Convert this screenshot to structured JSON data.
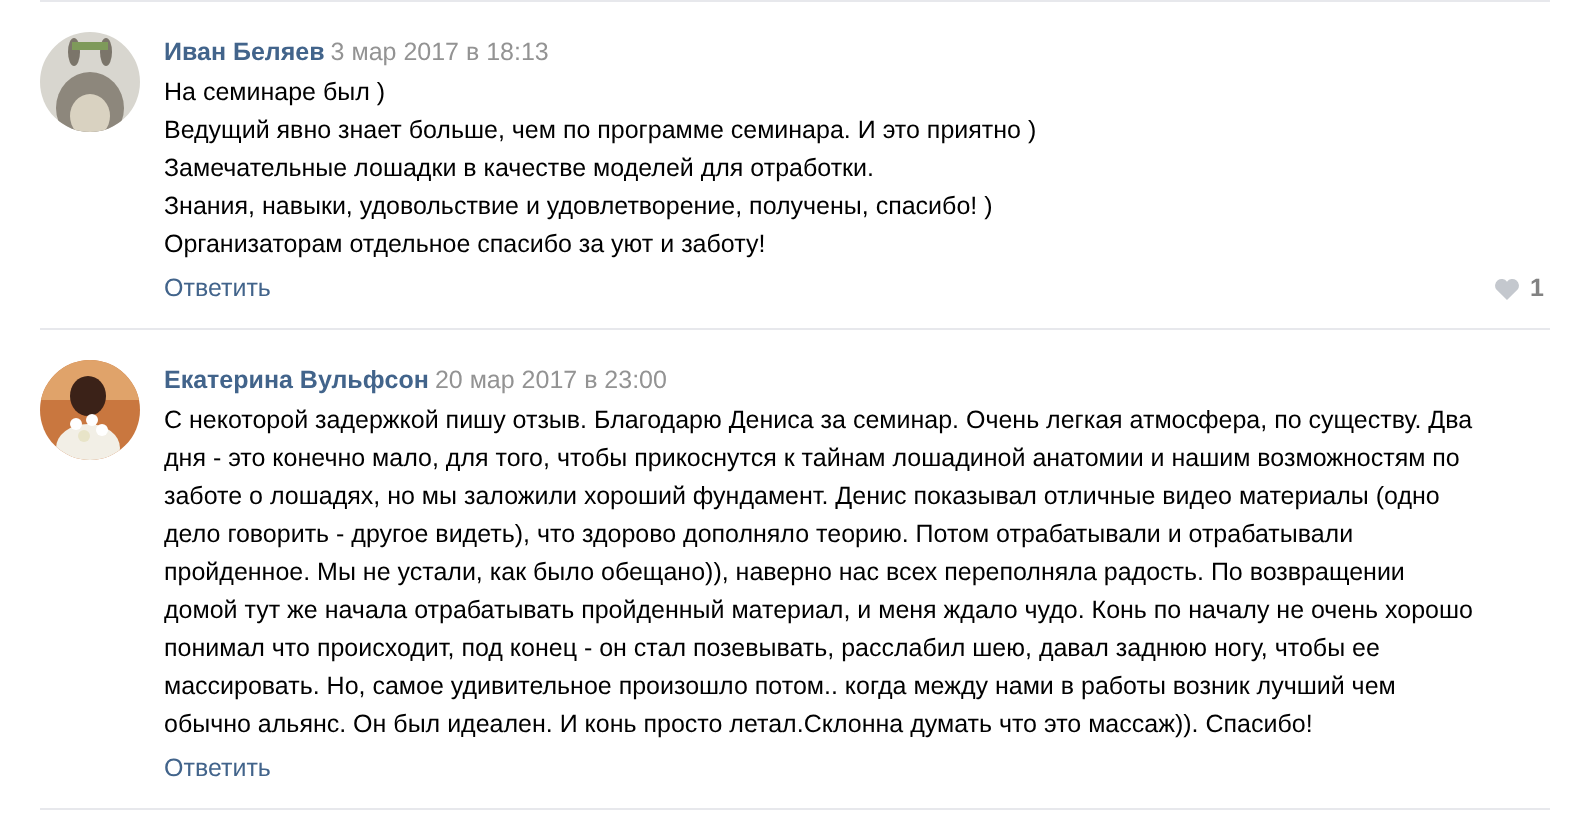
{
  "comments": [
    {
      "author": "Иван Беляев",
      "date": "3 мар 2017 в 18:13",
      "text": "На семинаре был )\nВедущий явно знает больше, чем по программе семинара. И это приятно )\nЗамечательные лошадки в качестве моделей для отработки.\nЗнания, навыки, удовольствие и удовлетворение, получены, спасибо! )\nОрганизаторам отдельное спасибо за уют и заботу!",
      "reply": "Ответить",
      "likes": "1"
    },
    {
      "author": "Екатерина Вульфсон",
      "date": "20 мар 2017 в 23:00",
      "text": "С некоторой задержкой пишу отзыв. Благодарю Дениса за семинар. Очень легкая атмосфера, по существу. Два\nдня - это конечно мало, для того, чтобы прикоснутся к тайнам лошадиной анатомии и нашим возможностям по\nзаботе о лошадях, но мы заложили хороший фундамент. Денис показывал отличные видео материалы (одно\nдело говорить - другое видеть), что здорово дополняло теорию. Потом отрабатывали и отрабатывали\nпройденное. Мы не устали, как было обещано)), наверно нас всех переполняла радость. По возвращении\nдомой тут же начала отрабатывать пройденный материал, и меня ждало чудо. Конь по началу не очень хорошо\nпонимал что происходит, под конец - он стал позевывать, расслабил шею, давал заднюю ногу, чтобы ее\nмассировать. Но, самое удивительное произошло потом.. когда между нами в работы возник лучший чем\nобычно альянс. Он был идеален. И конь просто летал.Склонна думать что это массаж)). Спасибо!",
      "reply": "Ответить"
    }
  ]
}
